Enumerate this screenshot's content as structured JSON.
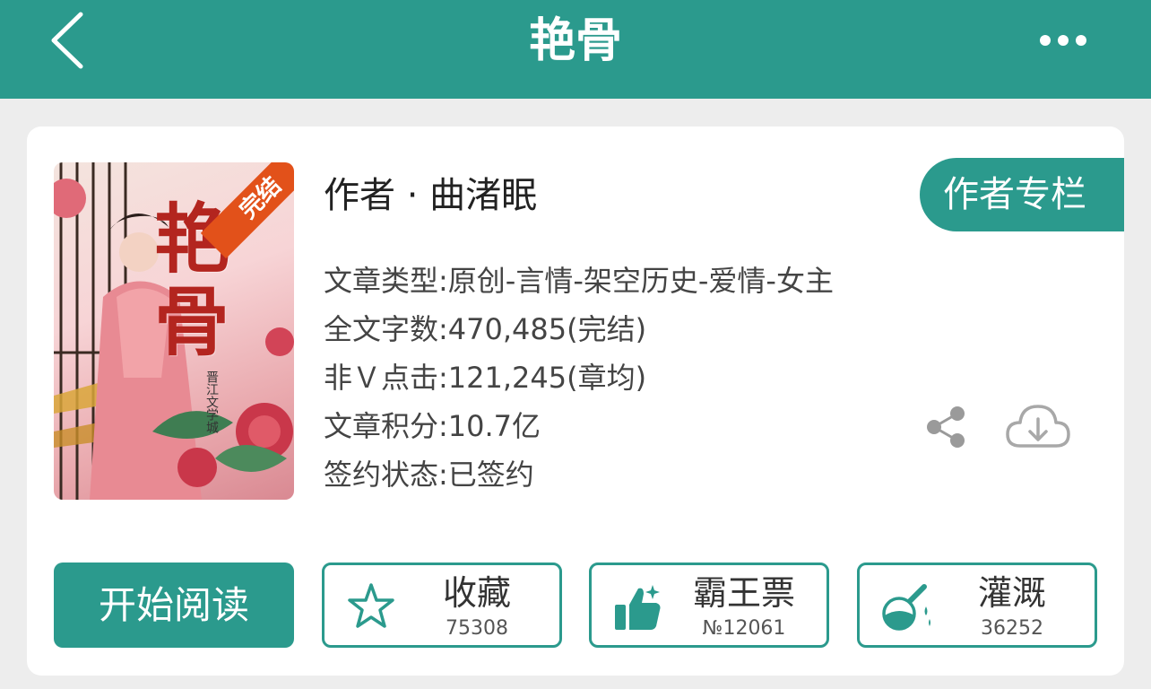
{
  "header": {
    "title": "艳骨",
    "back_icon": "chevron-left-icon",
    "more_icon": "more-horizontal-icon",
    "color": "#2b9a8d"
  },
  "book": {
    "cover": {
      "title_text": "艳骨",
      "status_ribbon": "完结",
      "publisher": "晋江文学城"
    },
    "author_line": "作者 · 曲渚眠",
    "author_column_button": "作者专栏",
    "meta": [
      "文章类型:原创-言情-架空历史-爱情-女主",
      "全文字数:470,485(完结)",
      "非Ｖ点击:121,245(章均)",
      "文章积分:10.7亿",
      "签约状态:已签约"
    ]
  },
  "actions": {
    "start_reading": "开始阅读",
    "favorite": {
      "label": "收藏",
      "count": "75308",
      "icon": "star-icon"
    },
    "overlord_ticket": {
      "label": "霸王票",
      "count": "№12061",
      "icon": "thumbs-up-icon"
    },
    "irrigate": {
      "label": "灌溉",
      "count": "36252",
      "icon": "flask-icon"
    },
    "share_icon": "share-icon",
    "download_icon": "cloud-download-icon"
  }
}
